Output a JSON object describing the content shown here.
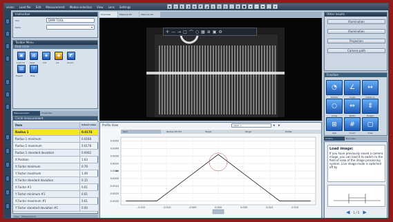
{
  "menu": [
    "vision",
    "Load file",
    "Edit",
    "Measurement",
    "Modes selection",
    "View",
    "Lens",
    "Settings"
  ],
  "toolbar_icons": [
    "▣",
    "▤",
    "◧",
    "◨",
    "▦",
    "◩",
    "◪",
    "▥",
    "▧",
    "▨",
    "◫",
    "▩",
    "■",
    "▪",
    "▫",
    "▬",
    "□",
    "◈"
  ],
  "left": {
    "title": "Instruction",
    "tool_label": "Tool",
    "tool_value": "DMM TOOL",
    "mode_label": "Mode",
    "tools_panel": "Toolbar Menu",
    "tools_sub": "Find circle",
    "tools": [
      "Load Im",
      "Save",
      "Cnt",
      "Ins",
      "Annot",
      "Export",
      "Help"
    ],
    "tabs": [
      "Measurements",
      "Properties"
    ],
    "table_header": "Circle measurement",
    "col_name": "Item",
    "col_value": "Actual value",
    "rows": [
      {
        "name": "Radius 1",
        "value": "0.0174"
      },
      {
        "name": "Radius 1 minimum",
        "value": "0.0168"
      },
      {
        "name": "Radius 1 maximum",
        "value": "0.0178"
      },
      {
        "name": "Radius 1 standard deviation",
        "value": "0.0002"
      },
      {
        "name": "X Position",
        "value": "1.63"
      },
      {
        "name": "X Factor minimum",
        "value": "0.79"
      },
      {
        "name": "Y Factor maximum",
        "value": "1.49"
      },
      {
        "name": "X Factor standard deviation",
        "value": "0.15"
      },
      {
        "name": "X Factor #1",
        "value": "0.61"
      },
      {
        "name": "Y Factor minimum #1",
        "value": "0.61"
      },
      {
        "name": "X Factor maximum #1",
        "value": "0.61"
      },
      {
        "name": "Y Factor standard deviation #1",
        "value": "0.00"
      }
    ],
    "status_tabs": [
      "Layer",
      "Measurement"
    ]
  },
  "center": {
    "tabs": [
      "Overview",
      "Measure #1",
      "Measure #2"
    ],
    "profile_title": "Profile View",
    "layer_select": "Layer 1",
    "profile_cols": [
      "Item",
      "Radius (25 PX)",
      "Target",
      "Target",
      "Profile"
    ],
    "y_ticks": [
      "0.0050",
      "0.0040",
      "0.0030",
      "0.0020",
      "0.0010",
      "0.0000",
      "-0.0010",
      "-0.0020",
      "-0.0030"
    ],
    "x_ticks": [
      "-0.015",
      "-0.010",
      "-0.005",
      "0.000",
      "0.005",
      "0.010",
      "0.015"
    ],
    "profile_points": [
      [
        -0.018,
        -0.003
      ],
      [
        -0.012,
        -0.003
      ],
      [
        0,
        0.0032
      ],
      [
        0.012,
        -0.003
      ],
      [
        0.018,
        -0.003
      ]
    ]
  },
  "right": {
    "title": "Other results",
    "items": [
      "Illumination",
      "Illumination",
      "Projection",
      "Camera path"
    ],
    "func_title": "Function",
    "func_tiles": [
      "Radius",
      "Angle",
      "Distance",
      "Circle",
      "Width",
      "Height",
      "Gap",
      "Count",
      "Area",
      "Profile"
    ],
    "tabs": [
      "Actions",
      "Run view"
    ],
    "help_title": "Load image:",
    "help_body": "If you have previously saved a camera image, you can load it to switch to the field of view of the image processing system. Live image mode is switched off by",
    "pager": "1 / 5"
  }
}
